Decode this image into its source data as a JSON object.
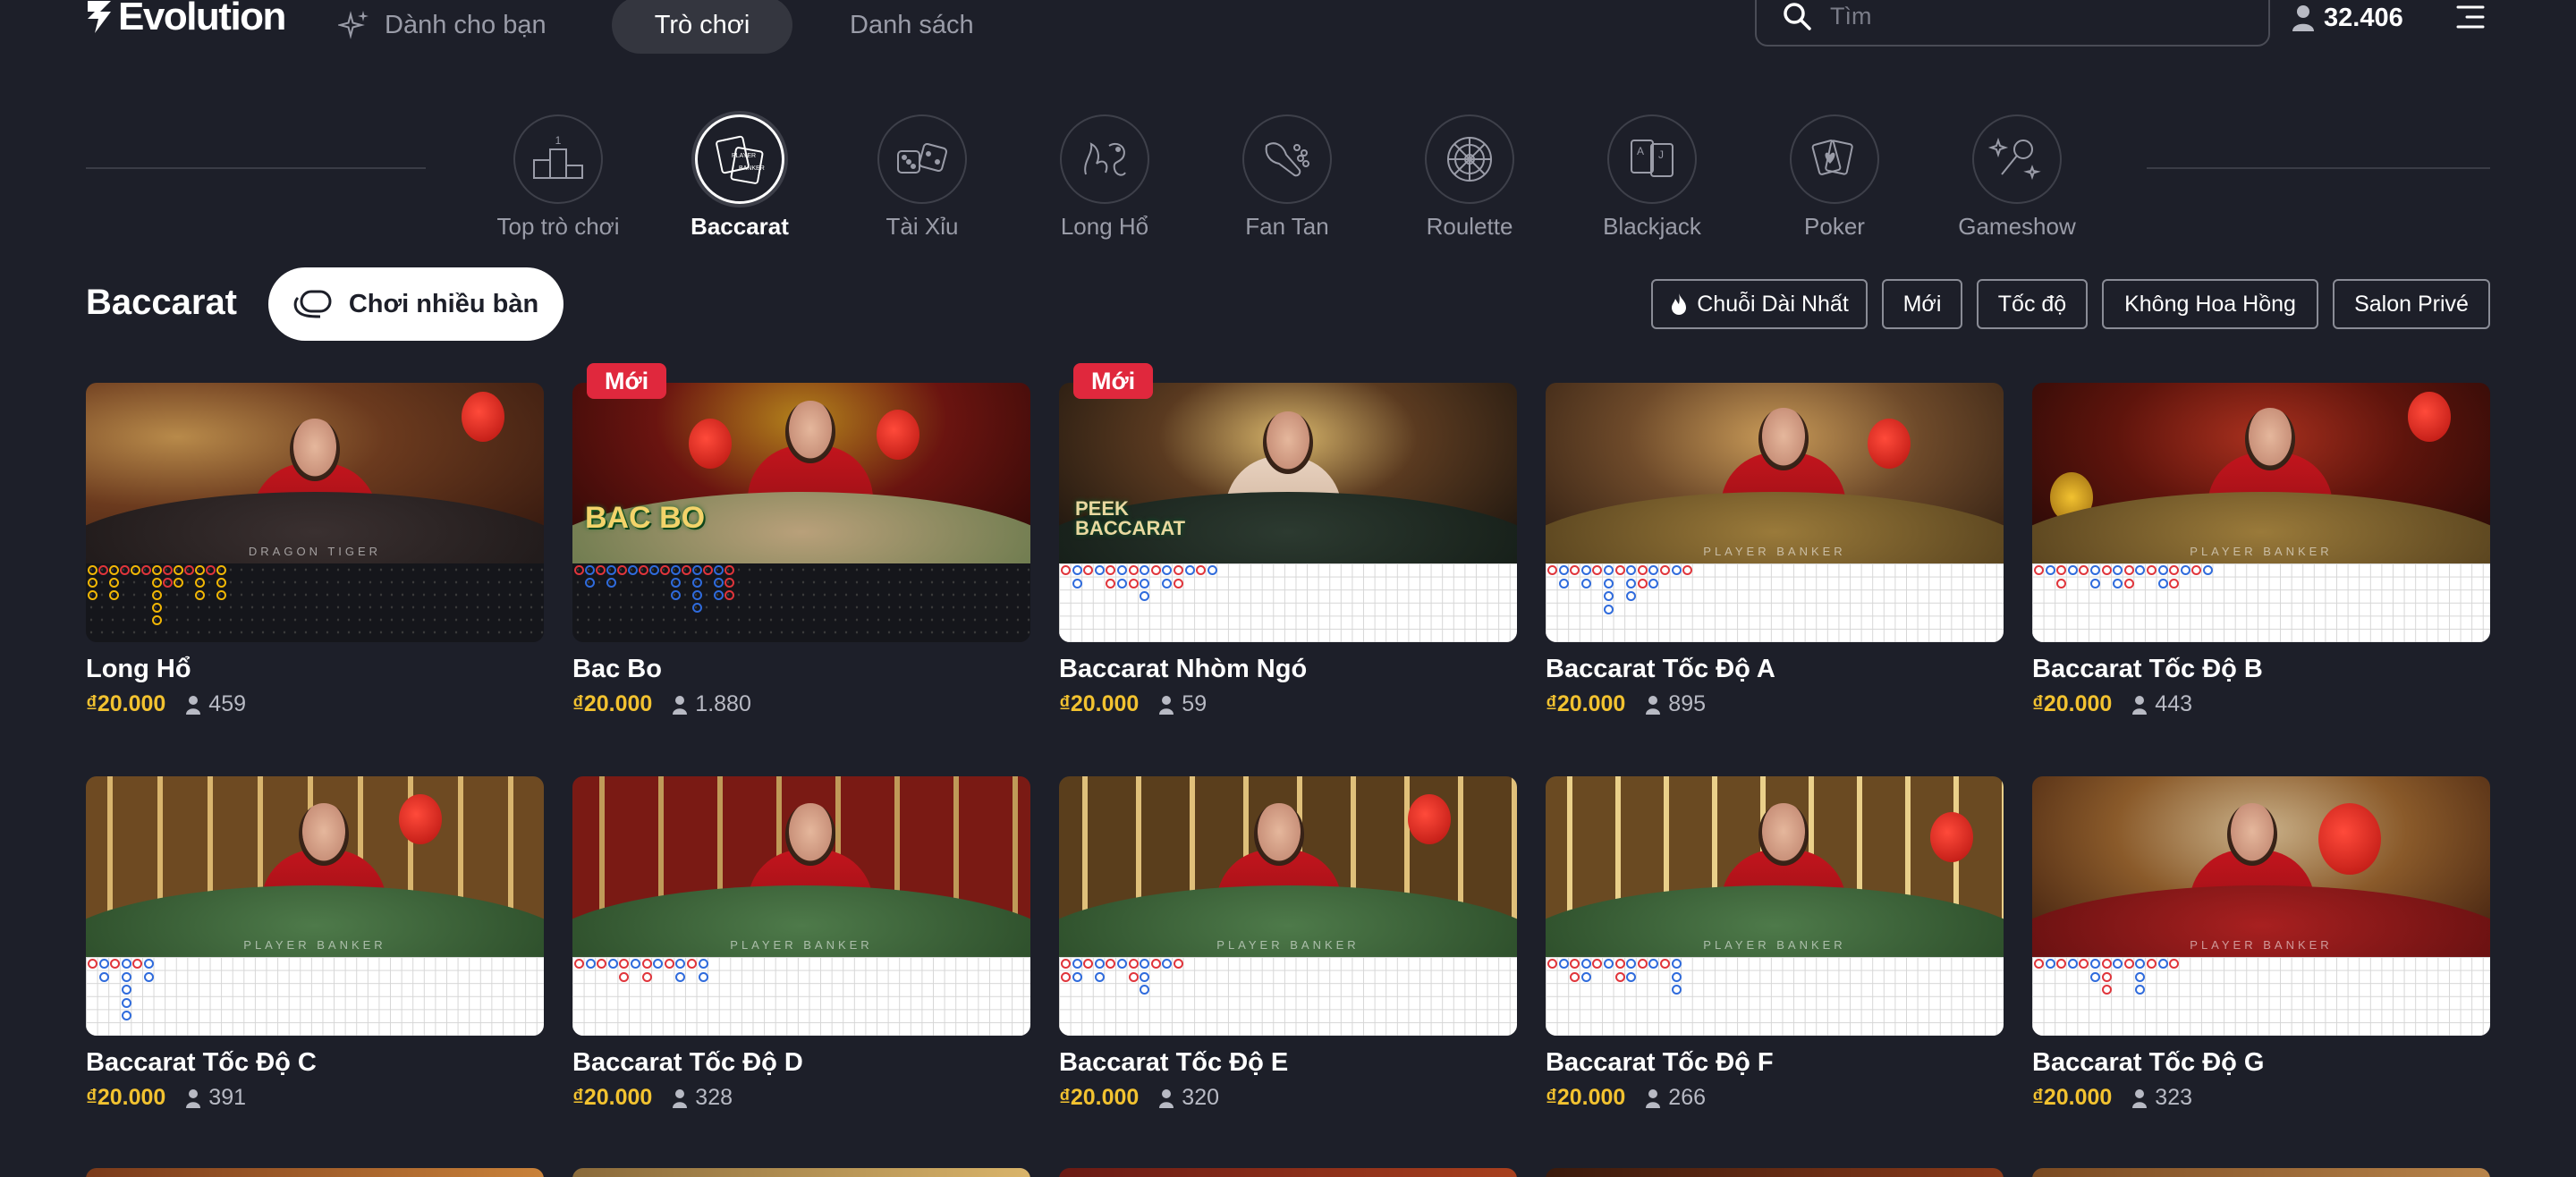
{
  "brand": {
    "name": "Evolution"
  },
  "nav": {
    "for_you": "Dành cho bạn",
    "games": "Trò chơi",
    "lists": "Danh sách",
    "search_placeholder": "Tìm",
    "players_total": "32.406"
  },
  "categories": [
    {
      "label": "Top trò chơi",
      "icon": "podium-icon",
      "active": false
    },
    {
      "label": "Baccarat",
      "icon": "baccarat-cards-icon",
      "active": true
    },
    {
      "label": "Tài Xỉu",
      "icon": "dice-icon",
      "active": false
    },
    {
      "label": "Long Hổ",
      "icon": "dragon-tiger-icon",
      "active": false
    },
    {
      "label": "Fan Tan",
      "icon": "fan-tan-icon",
      "active": false
    },
    {
      "label": "Roulette",
      "icon": "roulette-wheel-icon",
      "active": false
    },
    {
      "label": "Blackjack",
      "icon": "blackjack-cards-icon",
      "active": false
    },
    {
      "label": "Poker",
      "icon": "poker-chips-icon",
      "active": false
    },
    {
      "label": "Gameshow",
      "icon": "microphone-icon",
      "active": false
    }
  ],
  "section": {
    "title": "Baccarat",
    "multi_play": "Chơi nhiều bàn",
    "filters": [
      "Chuỗi Dài Nhất",
      "Mới",
      "Tốc độ",
      "Không Hoa Hồng",
      "Salon Privé"
    ]
  },
  "badge_new": "Mới",
  "games": [
    {
      "name": "Long Hổ",
      "price": "₫20.000",
      "players": "459",
      "new": false,
      "table_text": "DRAGON    TIGER"
    },
    {
      "name": "Bac Bo",
      "price": "₫20.000",
      "players": "1.880",
      "new": true,
      "logo_text": "BAC BO"
    },
    {
      "name": "Baccarat Nhòm Ngó",
      "price": "₫20.000",
      "players": "59",
      "new": true,
      "logo_text": "PEEK BACCARAT"
    },
    {
      "name": "Baccarat Tốc Độ A",
      "price": "₫20.000",
      "players": "895",
      "new": false,
      "table_text": "PLAYER    BANKER"
    },
    {
      "name": "Baccarat Tốc Độ B",
      "price": "₫20.000",
      "players": "443",
      "new": false,
      "table_text": "PLAYER    BANKER"
    },
    {
      "name": "Baccarat Tốc Độ C",
      "price": "₫20.000",
      "players": "391",
      "new": false,
      "table_text": "PLAYER    BANKER"
    },
    {
      "name": "Baccarat Tốc Độ D",
      "price": "₫20.000",
      "players": "328",
      "new": false,
      "table_text": "PLAYER    BANKER"
    },
    {
      "name": "Baccarat Tốc Độ E",
      "price": "₫20.000",
      "players": "320",
      "new": false,
      "table_text": "PLAYER    BANKER"
    },
    {
      "name": "Baccarat Tốc Độ F",
      "price": "₫20.000",
      "players": "266",
      "new": false,
      "table_text": "PLAYER    BANKER"
    },
    {
      "name": "Baccarat Tốc Độ G",
      "price": "₫20.000",
      "players": "323",
      "new": false,
      "table_text": "PLAYER    BANKER"
    }
  ],
  "colors": {
    "background": "#1d1f29",
    "price": "#f2c230",
    "badge_new": "#e0283d",
    "banker_bead": "#e0353b",
    "player_bead": "#2f6bdc",
    "dragon_tiger_bead": "#f2b705"
  }
}
